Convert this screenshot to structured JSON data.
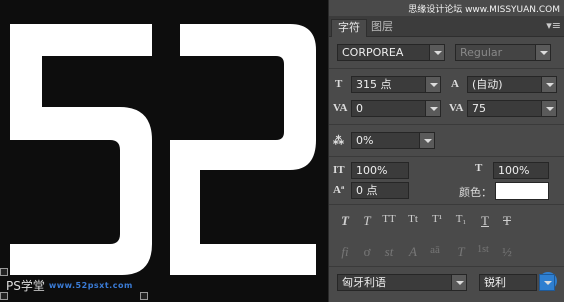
{
  "canvas": {
    "glyph_color": "#ffffff",
    "watermark_left_ps": "PS学堂",
    "watermark_left_site": "www.52psxt.com"
  },
  "panel": {
    "watermark_top": "思缘设计论坛 www.MISSYUAN.COM",
    "tabs": [
      {
        "label": "字符",
        "active": true
      },
      {
        "label": "图层",
        "active": false
      }
    ],
    "menu_icon": "panel-menu-icon",
    "font_family": "CORPOREA",
    "font_style": "Regular",
    "font_size": "315 点",
    "leading": "(自动)",
    "kerning": "0",
    "tracking": "75",
    "baseline_scale": "0%",
    "vertical_scale": "100%",
    "horizontal_scale": "100%",
    "baseline_shift": "0 点",
    "color_label": "颜色：",
    "color_value": "#ffffff",
    "style_buttons": [
      "T",
      "T",
      "TT",
      "Tt",
      "T¹",
      "T₁",
      "T",
      "T"
    ],
    "opentype_buttons": [
      "fi",
      "ơ",
      "st",
      "A",
      "aā",
      "T",
      "1st",
      "½"
    ],
    "language": "匈牙利语",
    "antialias": "锐利",
    "aa_badge": "aa"
  }
}
